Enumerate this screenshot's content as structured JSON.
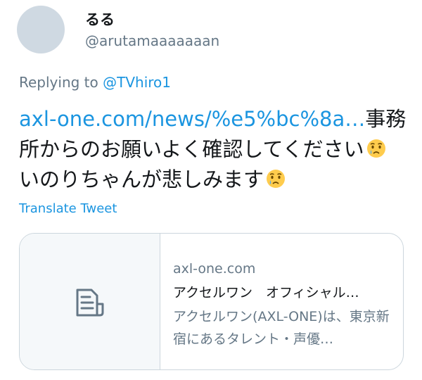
{
  "user": {
    "display_name": "るる",
    "handle": "@arutamaaaaaaan"
  },
  "reply": {
    "prefix": "Replying to ",
    "mention": "@TVhiro1"
  },
  "tweet": {
    "link_text": "axl-one.com/news/%e5%bc%8a…",
    "text_part1": "事務所からのお願いよく確認してください",
    "emoji_1": "crying-face-emoji",
    "text_part2": " いのりちゃんが悲しみます",
    "emoji_2": "crying-face-emoji"
  },
  "translate_label": "Translate Tweet",
  "card": {
    "thumbnail_icon": "document-icon",
    "domain": "axl-one.com",
    "title": "アクセルワン　オフィシャル…",
    "description": "アクセルワン(AXL-ONE)は、東京新宿にあるタレント・声優…"
  },
  "colors": {
    "link": "#1b95e0",
    "secondary_text": "#657786",
    "primary_text": "#14171a",
    "border": "#ccd6dd",
    "avatar_placeholder": "#cfd9e2"
  }
}
